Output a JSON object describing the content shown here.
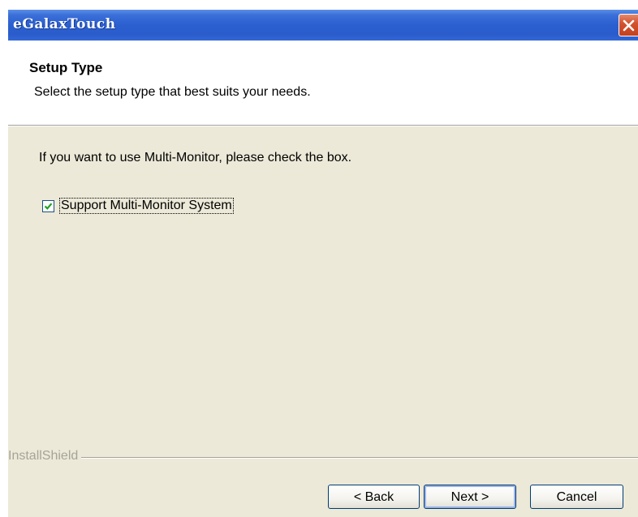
{
  "window": {
    "title": "eGalaxTouch"
  },
  "header": {
    "title": "Setup Type",
    "subtitle": "Select the setup type that best suits your needs."
  },
  "body": {
    "instruction": "If you want to use Multi-Monitor, please check the box.",
    "checkbox": {
      "label": "Support Multi-Monitor System",
      "checked": true
    }
  },
  "footer": {
    "brand": "InstallShield"
  },
  "buttons": {
    "back": "< Back",
    "next": "Next >",
    "cancel": "Cancel"
  },
  "icons": {
    "close": "close-icon",
    "checkmark": "checkmark-icon"
  },
  "colors": {
    "titlebar": "#2b5fd0",
    "close_button": "#d4532f",
    "dialog_background": "#ece9d8",
    "header_background": "#ffffff",
    "checkmark": "#21a121"
  }
}
